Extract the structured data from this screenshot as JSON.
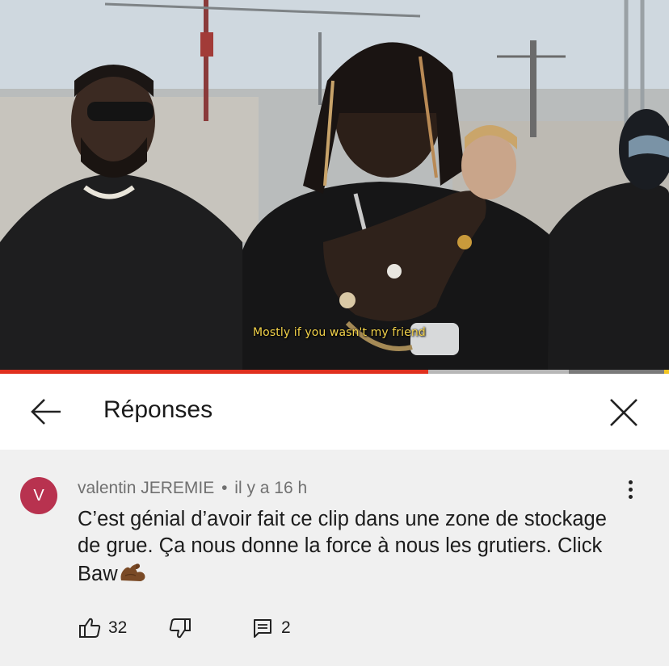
{
  "video": {
    "subtitle": "Mostly if you wasn't my friend",
    "progress": 0.64,
    "buffered": 0.85
  },
  "header": {
    "back_icon": "arrow-left-icon",
    "title": "Réponses",
    "close_icon": "close-x-icon"
  },
  "comment": {
    "avatar_letter": "V",
    "avatar_color": "#b8324f",
    "author": "valentin JEREMIE",
    "separator": "•",
    "time": "il y a 16 h",
    "text": "C’est génial d’avoir fait ce clip dans une zone de stockage de grue. Ça nous donne la force à nous les grutiers. Click Baw",
    "emoji": "flexed-biceps",
    "likes": "32",
    "replies": "2"
  },
  "colors": {
    "progress_played": "#e0301e",
    "background": "#f0f0f0"
  }
}
